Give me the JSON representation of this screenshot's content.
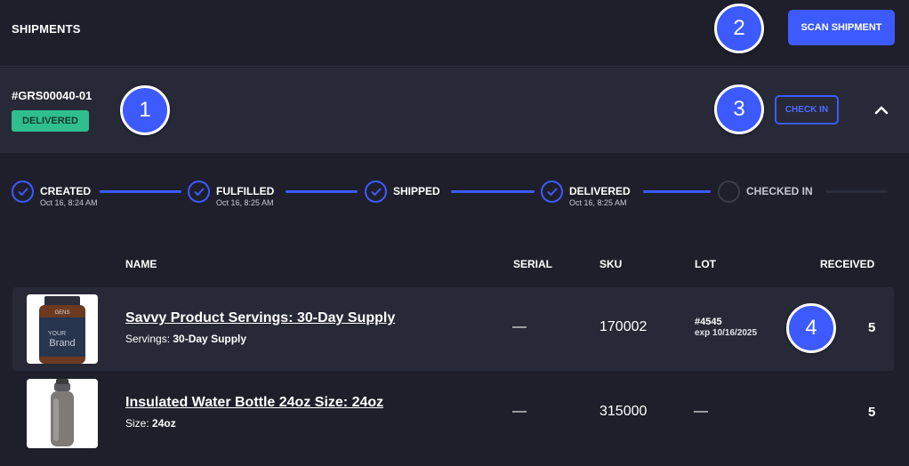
{
  "header": {
    "title": "SHIPMENTS",
    "scan_label": "SCAN SHIPMENT"
  },
  "shipment": {
    "id": "#GRS00040-01",
    "status": "DELIVERED",
    "checkin_label": "CHECK IN"
  },
  "timeline": [
    {
      "label": "CREATED",
      "date": "Oct 16, 8:24 AM",
      "done": true
    },
    {
      "label": "FULFILLED",
      "date": "Oct 16, 8:25 AM",
      "done": true
    },
    {
      "label": "SHIPPED",
      "date": "",
      "done": true
    },
    {
      "label": "DELIVERED",
      "date": "Oct 16, 8:25 AM",
      "done": true
    },
    {
      "label": "CHECKED IN",
      "date": "",
      "done": false
    }
  ],
  "table": {
    "columns": {
      "name": "NAME",
      "serial": "SERIAL",
      "sku": "SKU",
      "lot": "LOT",
      "received": "RECEIVED"
    },
    "rows": [
      {
        "name": "Savvy Product Servings: 30-Day Supply",
        "variant_key": "Servings:",
        "variant_value": "30-Day Supply",
        "serial": "—",
        "sku": "170002",
        "lot_number": "#4545",
        "lot_exp": "exp 10/16/2025",
        "received": "5",
        "image_text": {
          "top": "GENS",
          "line1": "YOUR",
          "line2": "Brand"
        }
      },
      {
        "name": "Insulated Water Bottle 24oz Size: 24oz",
        "variant_key": "Size:",
        "variant_value": "24oz",
        "serial": "—",
        "sku": "315000",
        "lot": "—",
        "received": "5"
      }
    ]
  },
  "markers": [
    "1",
    "2",
    "3",
    "4"
  ],
  "colors": {
    "accent": "#3d5afe",
    "success": "#2fbf8f",
    "background": "#1e1f2b",
    "panel": "#272937"
  }
}
